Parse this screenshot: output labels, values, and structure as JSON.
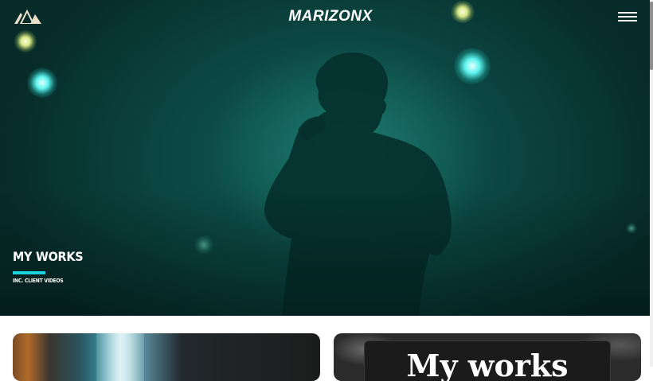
{
  "header": {
    "brand": "MARIZONX",
    "logo_icon": "mountain-logo-icon",
    "menu_icon": "hamburger-menu-icon"
  },
  "hero": {
    "title": "MY WORKS",
    "subtitle": "INC. CLIENT VIDEOS",
    "accent_color": "#19d4e0",
    "background_color": "#0b4440"
  },
  "cards": [
    {
      "image": "waterfall-thumbnail",
      "label": ""
    },
    {
      "image": "my-works-thumbnail",
      "label": "My works"
    }
  ]
}
